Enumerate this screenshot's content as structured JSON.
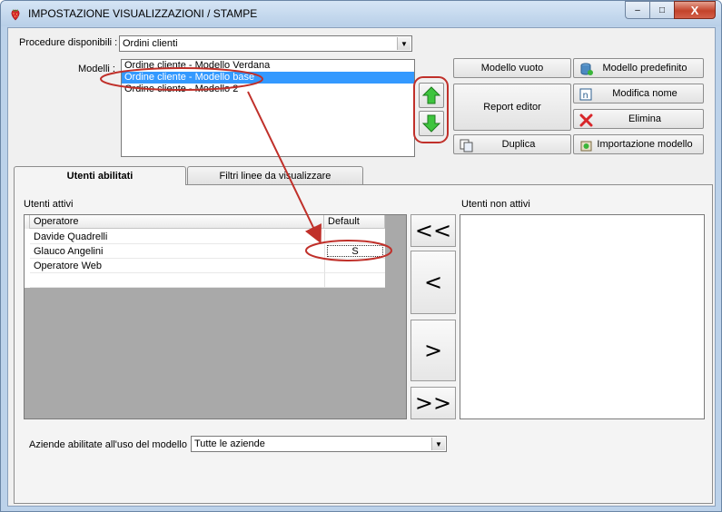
{
  "window": {
    "title": "IMPOSTAZIONE VISUALIZZAZIONI / STAMPE",
    "minimize_glyph": "–",
    "maximize_glyph": "□",
    "close_glyph": "X"
  },
  "procedures": {
    "label": "Procedure disponibili :",
    "selected": "Ordini clienti"
  },
  "models": {
    "label": "Modelli :",
    "items": [
      {
        "label": "Ordine cliente - Modello Verdana",
        "selected": false
      },
      {
        "label": "Ordine cliente - Modello base",
        "selected": true
      },
      {
        "label": "Ordine cliente - Modello 2",
        "selected": false
      }
    ]
  },
  "model_buttons": {
    "modello_vuoto": "Modello vuoto",
    "modello_predefinito": "Modello predefinito",
    "report_editor": "Report editor",
    "modifica_nome": "Modifica nome",
    "elimina": "Elimina",
    "duplica": "Duplica",
    "importazione_modello": "Importazione modello"
  },
  "tabs": [
    {
      "label": "Utenti abilitati",
      "active": true
    },
    {
      "label": "Filtri linee da visualizzare",
      "active": false
    }
  ],
  "users": {
    "active_label": "Utenti attivi",
    "inactive_label": "Utenti non attivi",
    "columns": [
      "Operatore",
      "Default"
    ],
    "rows": [
      {
        "operator": "Davide Quadrelli",
        "default": ""
      },
      {
        "operator": "Glauco Angelini",
        "default": "S"
      },
      {
        "operator": "Operatore Web",
        "default": ""
      }
    ],
    "move_buttons": [
      "<<",
      "<",
      ">",
      ">>"
    ]
  },
  "aziende": {
    "label": "Aziende abilitate all'uso del modello :",
    "selected": "Tutte le aziende"
  },
  "colors": {
    "selection": "#3399ff",
    "annotation": "#c0302a",
    "arrow_green": "#2fb52f",
    "grid_background": "#a9a9a9"
  }
}
